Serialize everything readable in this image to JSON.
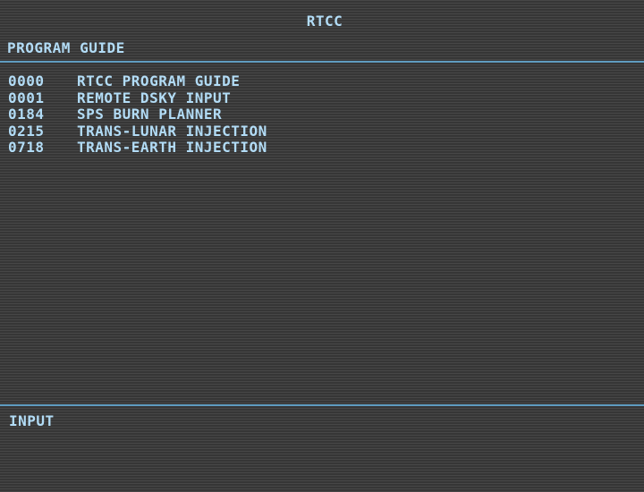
{
  "header": {
    "system_title": "RTCC",
    "page_title": "PROGRAM GUIDE"
  },
  "programs": [
    {
      "code": "0000",
      "name": "RTCC PROGRAM GUIDE"
    },
    {
      "code": "0001",
      "name": "REMOTE DSKY INPUT"
    },
    {
      "code": "0184",
      "name": "SPS BURN PLANNER"
    },
    {
      "code": "0215",
      "name": "TRANS-LUNAR INJECTION"
    },
    {
      "code": "0718",
      "name": "TRANS-EARTH INJECTION"
    }
  ],
  "footer": {
    "input_label": "INPUT",
    "input_value": ""
  },
  "colors": {
    "text": "#b2dcf6",
    "rule": "#5f9cc0",
    "background": "#414141"
  }
}
